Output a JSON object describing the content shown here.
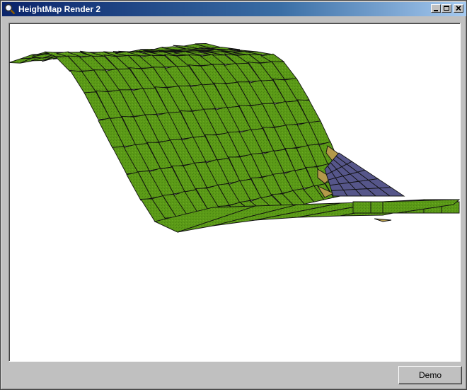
{
  "window": {
    "title": "HeightMap Render 2",
    "app_icon": "magnifier-icon",
    "controls": {
      "minimize": "minimize-icon",
      "maximize": "maximize-icon",
      "close": "close-icon"
    }
  },
  "render": {
    "colors": {
      "grass": "#5b9a17",
      "grass_dark": "#4a8512",
      "sand": "#b39a4a",
      "water": "#56568a",
      "grid_line": "#101010",
      "background": "#ffffff"
    }
  },
  "footer": {
    "demo_label": "Demo"
  }
}
